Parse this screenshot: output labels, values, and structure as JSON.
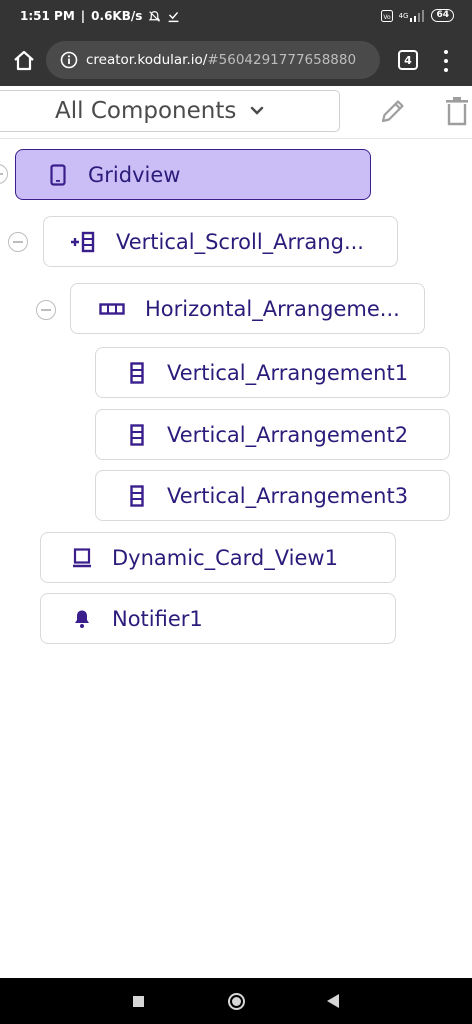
{
  "status_bar": {
    "time": "1:51 PM",
    "speed": "0.6KB/s",
    "network": "4G",
    "battery": "64"
  },
  "browser": {
    "url_host": "creator.kodular.io/",
    "url_fragment": "#5604291777658880",
    "tab_count": "4"
  },
  "toolbar": {
    "dropdown_label": "All Components"
  },
  "tree": {
    "gridview": "Gridview",
    "vertical_scroll": "Vertical_Scroll_Arrang...",
    "horizontal": "Horizontal_Arrangeme...",
    "vertical1": "Vertical_Arrangement1",
    "vertical2": "Vertical_Arrangement2",
    "vertical3": "Vertical_Arrangement3",
    "card_view": "Dynamic_Card_View1",
    "notifier": "Notifier1"
  },
  "colors": {
    "accent": "#3a1f8c",
    "selected_bg": "#cbbdf5",
    "icon": "#3a1f8c"
  }
}
